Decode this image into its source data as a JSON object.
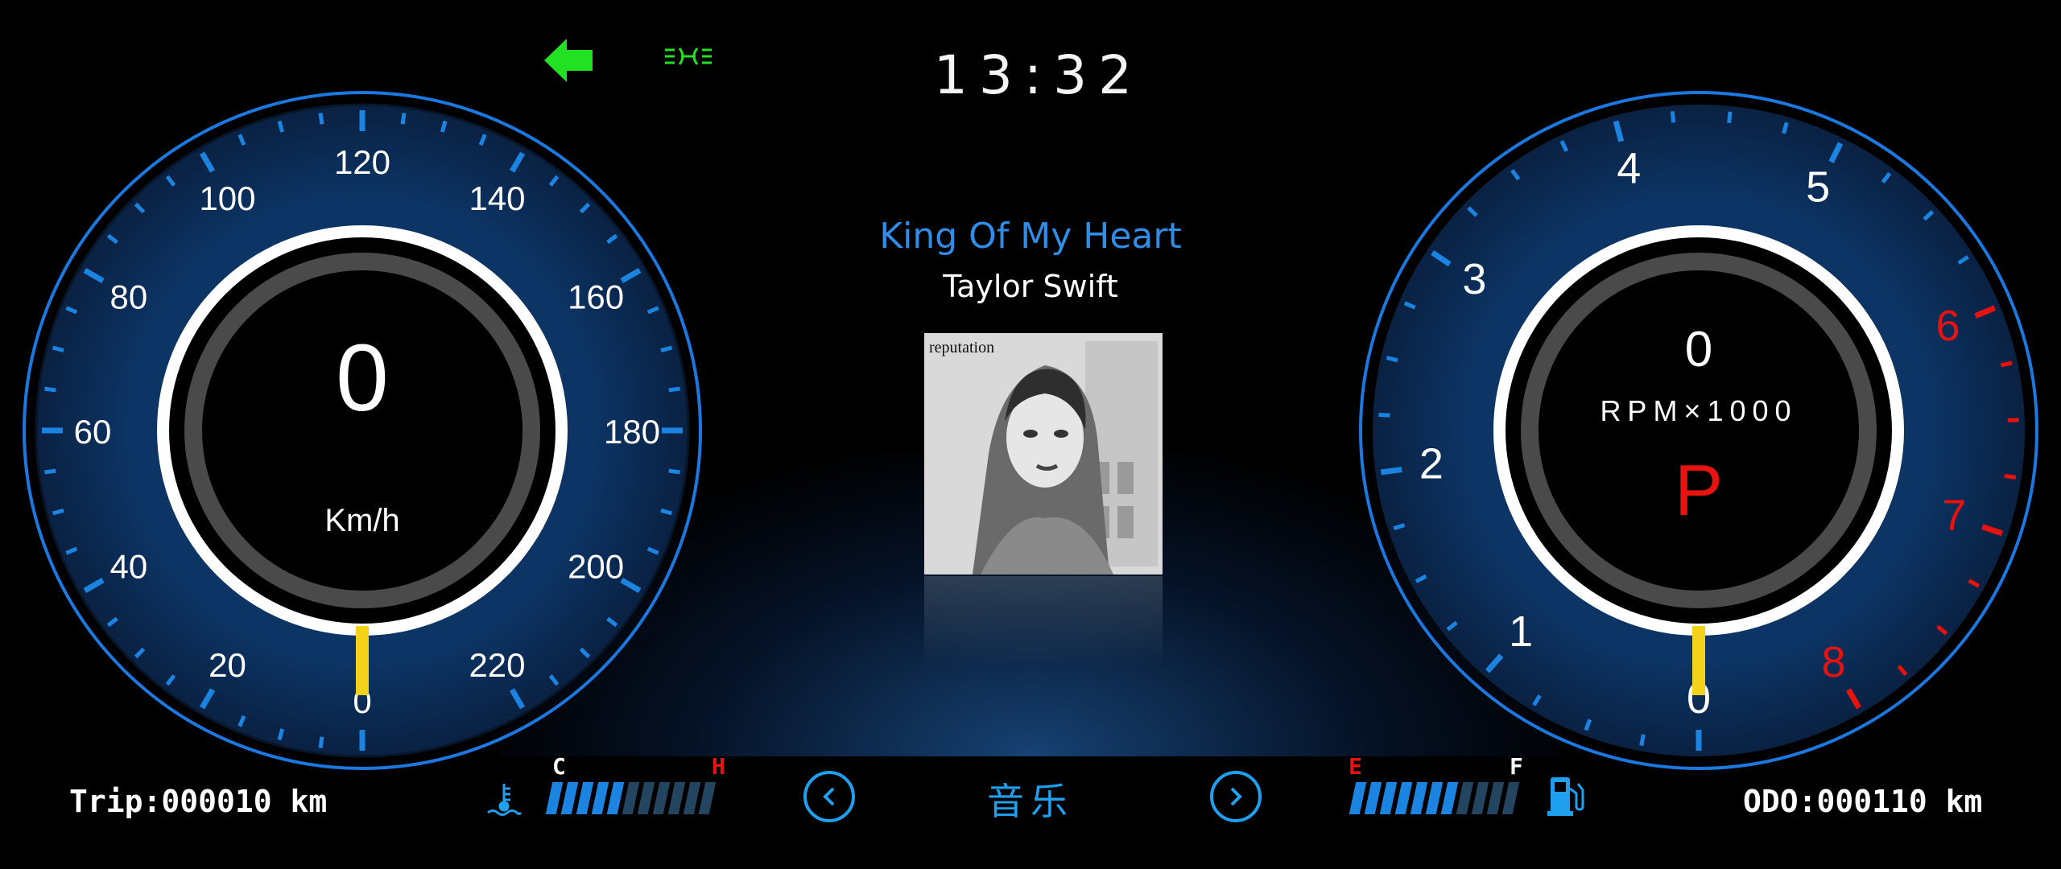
{
  "header": {
    "time": "13:32",
    "turn_signal_icon": "left-arrow-icon",
    "parking_light_icon": "parking-light-icon",
    "colors": {
      "indicator_green": "#22e022"
    }
  },
  "speedometer": {
    "value": "0",
    "unit": "Km/h",
    "ticks": [
      "0",
      "20",
      "40",
      "60",
      "80",
      "100",
      "120",
      "140",
      "160",
      "180",
      "200",
      "220"
    ],
    "min": 0,
    "max": 220
  },
  "tachometer": {
    "value": "0",
    "unit": "RPM×1000",
    "gear": "P",
    "ticks": [
      "0",
      "1",
      "2",
      "3",
      "4",
      "5",
      "6",
      "7",
      "8"
    ],
    "redline_from": 6,
    "colors": {
      "gear": "#e8130f",
      "redline": "#e8130f"
    }
  },
  "media": {
    "title": "King Of My Heart",
    "artist": "Taylor Swift",
    "album_cover_text": "reputation",
    "source_label": "音乐",
    "prev_icon": "chevron-left-icon",
    "next_icon": "chevron-right-icon"
  },
  "coolant": {
    "icon": "coolant-temp-icon",
    "low_label": "C",
    "high_label": "H",
    "level": 0.45
  },
  "fuel": {
    "icon": "fuel-pump-icon",
    "low_label": "E",
    "high_label": "F",
    "level": 0.65
  },
  "odometer": {
    "trip": "Trip:000010 km",
    "odo": "ODO:000110 km"
  }
}
